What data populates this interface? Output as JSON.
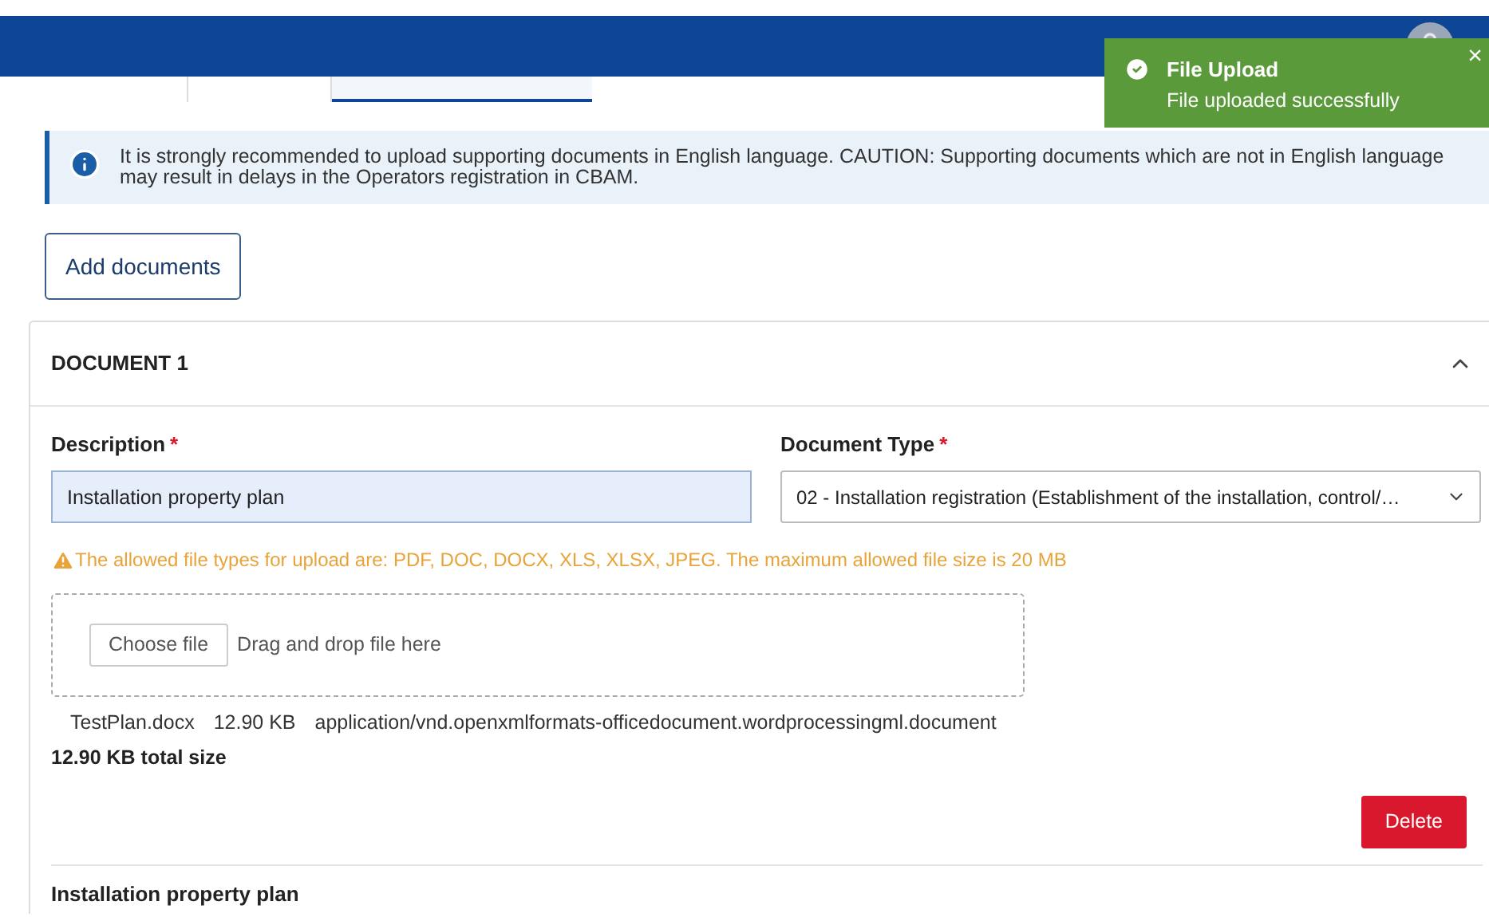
{
  "header": {
    "tabs": [
      {
        "selected": false
      },
      {
        "selected": false
      },
      {
        "selected": true
      }
    ]
  },
  "toast": {
    "title": "File Upload",
    "message": "File uploaded successfully",
    "close": "×"
  },
  "alert": {
    "text": "It is strongly recommended to upload supporting documents in English language. CAUTION: Supporting documents which are not in English language may result in delays in the Operators registration in CBAM."
  },
  "add_button": "Add documents",
  "document": {
    "title": "DOCUMENT 1",
    "expanded": true,
    "description": {
      "label": "Description",
      "required": "*",
      "value": "Installation property plan"
    },
    "document_type": {
      "label": "Document Type",
      "required": "*",
      "value": "02 - Installation registration (Establishment of the installation, control/…"
    },
    "warning": "The allowed file types for upload are: PDF, DOC, DOCX, XLS, XLSX, JPEG. The maximum allowed file size is 20 MB",
    "upload": {
      "button": "Choose file",
      "hint": "Drag and drop file here"
    },
    "files": [
      {
        "name": "TestPlan.docx",
        "size": "12.90 KB",
        "type": "application/vnd.openxmlformats-officedocument.wordprocessingml.document"
      }
    ],
    "total": "12.90 KB total size",
    "delete_button": "Delete"
  },
  "next_document_title": "Installation property plan"
}
